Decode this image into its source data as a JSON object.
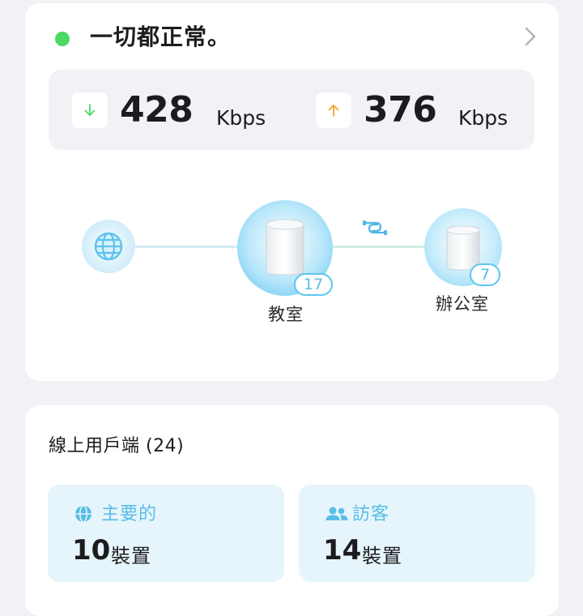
{
  "status": {
    "text": "一切都正常。",
    "indicator_color": "#4cd964"
  },
  "speed": {
    "download": {
      "value": "428",
      "unit": "Kbps",
      "icon": "arrow-down-icon",
      "color": "#4cd964"
    },
    "upload": {
      "value": "376",
      "unit": "Kbps",
      "icon": "arrow-up-icon",
      "color": "#f0a71f"
    }
  },
  "topology": {
    "internet_icon": "globe-icon",
    "connection_icon": "ethernet-cable-icon",
    "main_node": {
      "label": "教室",
      "devices": "17"
    },
    "satellite_node": {
      "label": "辦公室",
      "devices": "7"
    }
  },
  "clients": {
    "title": "線上用戶端 (24)",
    "primary": {
      "label": "主要的",
      "count": "10",
      "unit": "裝置",
      "icon": "globe-icon"
    },
    "guest": {
      "label": "訪客",
      "count": "14",
      "unit": "裝置",
      "icon": "users-icon"
    }
  },
  "colors": {
    "accent": "#58bde6",
    "tile_background": "#e6f5fb"
  }
}
